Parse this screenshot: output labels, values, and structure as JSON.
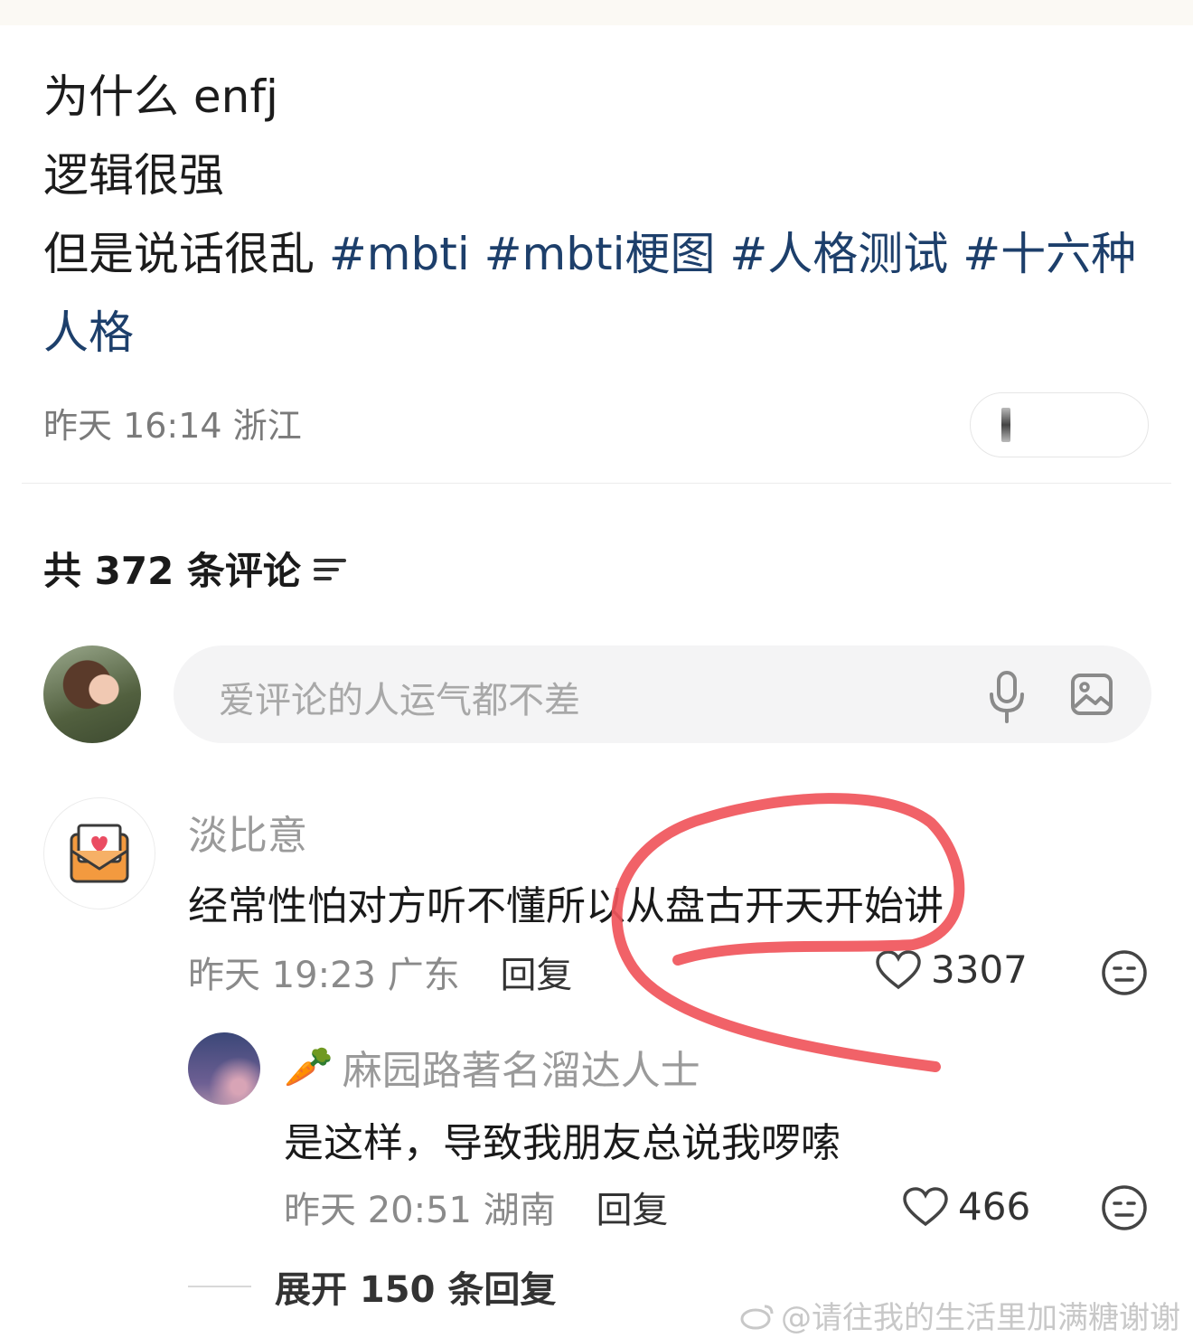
{
  "post": {
    "line1": "为什么 enfj",
    "line2": "逻辑很强",
    "line3_text": "但是说话很乱",
    "tags": [
      "#mbti",
      "#mbti梗图",
      "#人格测试",
      "#十六种人格"
    ],
    "time": "昨天 16:14",
    "location": "浙江"
  },
  "comments_header": {
    "label": "共 372 条评论"
  },
  "input": {
    "placeholder": "爱评论的人运气都不差"
  },
  "comment": {
    "username": "淡比意",
    "text": "经常性怕对方听不懂所以从盘古开天开始讲",
    "time": "昨天 19:23",
    "location": "广东",
    "reply_label": "回复",
    "likes": "3307"
  },
  "reply": {
    "badge": "🥕",
    "username": "麻园路著名溜达人士",
    "text": "是这样，导致我朋友总说我啰嗦",
    "time": "昨天 20:51",
    "location": "湖南",
    "reply_label": "回复",
    "likes": "466"
  },
  "expand": {
    "label": "展开 150 条回复"
  },
  "watermark": {
    "text": "@请往我的生活里加满糖谢谢"
  },
  "colors": {
    "hashtag": "#1d3f6b",
    "annotation_circle": "#f0555b"
  }
}
